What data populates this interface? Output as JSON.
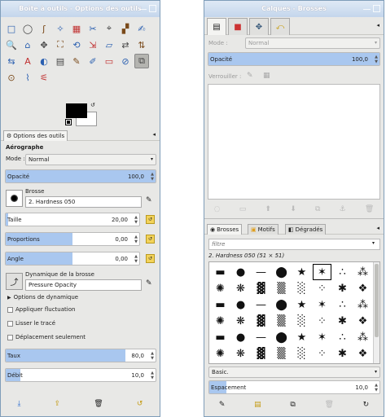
{
  "left": {
    "title": "Boîte à outils - Options des outils",
    "tools": [
      "□",
      "◯",
      "ʃ",
      "✧",
      "▦",
      "✂",
      "⌖",
      "▞",
      "✍",
      "🔍",
      "⌂",
      "✥",
      "⛶",
      "⟲",
      "⇲",
      "▱",
      "⇄",
      "⇅",
      "⇆",
      "A",
      "◐",
      "▤",
      "✎",
      "✐",
      "▭",
      "⊘",
      "⧉",
      "⊙",
      "⌇",
      "⚟"
    ],
    "dock_tab": "Options des outils",
    "tool_name": "Aérographe",
    "mode_label": "Mode :",
    "mode_value": "Normal",
    "opacity_label": "Opacité",
    "opacity_value": "100,0",
    "opacity_frac": 1.0,
    "brush_label": "Brosse",
    "brush_value": "2. Hardness 050",
    "size_label": "Taille",
    "size_value": "20,00",
    "size_frac": 0.02,
    "aspect_label": "Proportions",
    "aspect_value": "0,00",
    "aspect_frac": 0.5,
    "angle_label": "Angle",
    "angle_value": "0,00",
    "angle_frac": 0.5,
    "dyn_label": "Dynamique de la brosse",
    "dyn_value": "Pressure Opacity",
    "dyn_options": "Options de dynamique",
    "fluct": "Appliquer fluctuation",
    "smooth": "Lisser le tracé",
    "incremental": "Déplacement seulement",
    "rate_label": "Taux",
    "rate_value": "80,0",
    "rate_frac": 0.8,
    "flow_label": "Débit",
    "flow_value": "10,0",
    "flow_frac": 0.1
  },
  "right": {
    "title": "Calques - Brosses",
    "mode_label": "Mode :",
    "mode_value": "Normal",
    "opacity_label": "Opacité",
    "opacity_value": "100,0",
    "lock_label": "Verrouiller :",
    "tab_brushes": "Brosses",
    "tab_patterns": "Motifs",
    "tab_gradients": "Dégradés",
    "filter_placeholder": "filtre",
    "brush_info": "2. Hardness 050 (51 × 51)",
    "preset": "Basic.",
    "spacing_label": "Espacement",
    "spacing_value": "10,0",
    "spacing_frac": 0.1
  }
}
